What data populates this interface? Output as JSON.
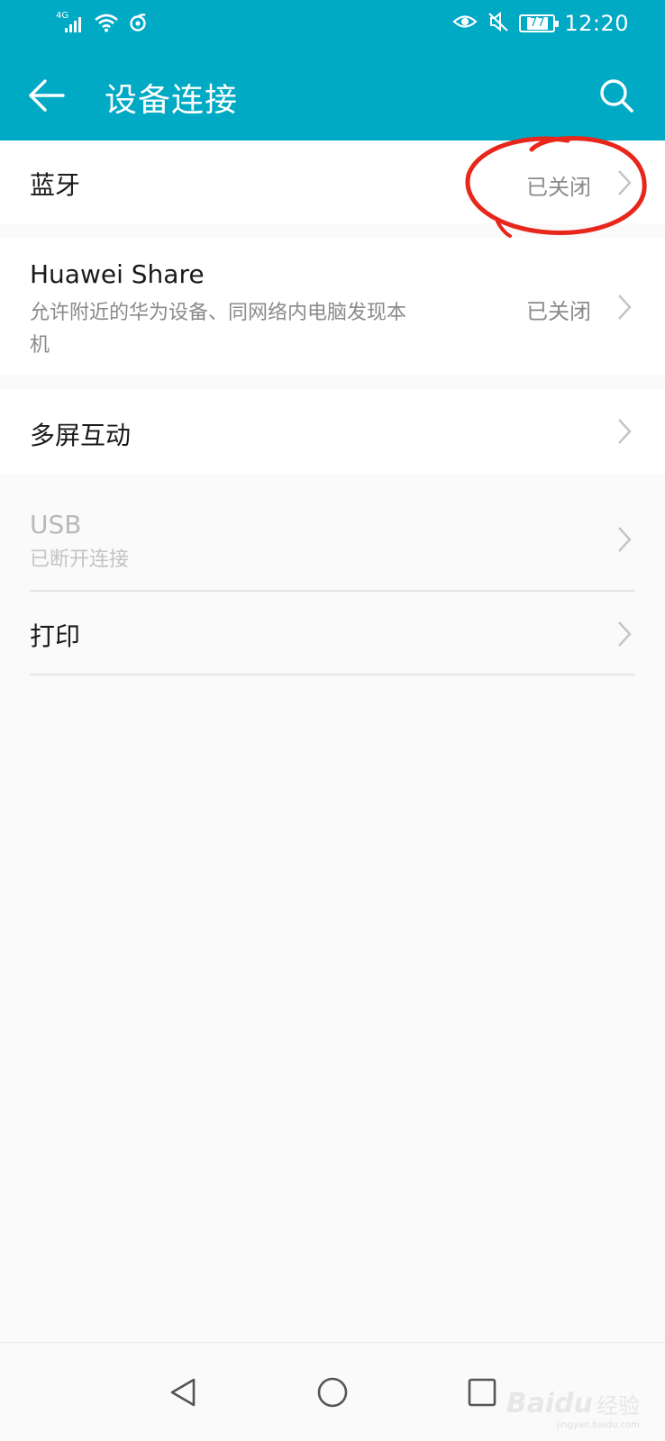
{
  "status_bar": {
    "network": "4G",
    "battery": "77",
    "time": "12:20"
  },
  "header": {
    "title": "设备连接"
  },
  "rows": {
    "bluetooth": {
      "label": "蓝牙",
      "status": "已关闭"
    },
    "huawei_share": {
      "label": "Huawei Share",
      "description": "允许附近的华为设备、同网络内电脑发现本机",
      "status": "已关闭"
    },
    "multiscreen": {
      "label": "多屏互动"
    },
    "usb": {
      "label": "USB",
      "description": "已断开连接",
      "disabled": true
    },
    "print": {
      "label": "打印"
    }
  },
  "watermark": {
    "brand": "Baidu",
    "cn": "经验",
    "site": "jingyan.baidu.com"
  },
  "colors": {
    "accent": "#00a9c4",
    "annotation": "#e8271c"
  }
}
